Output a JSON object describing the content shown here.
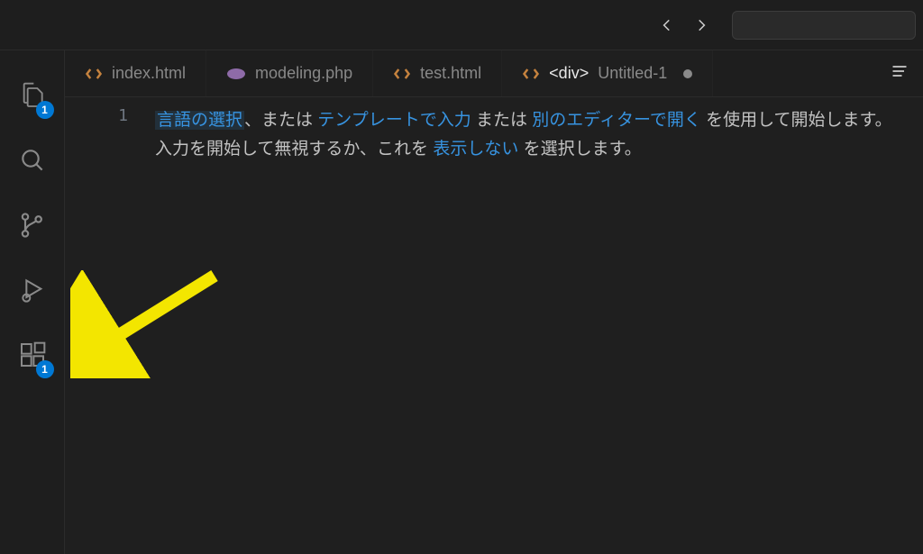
{
  "titlebar": {
    "back": "←",
    "forward": "→"
  },
  "activity": {
    "explorer_badge": "1",
    "extensions_badge": "1"
  },
  "tabs": [
    {
      "label": "index.html",
      "icon": "code",
      "active": false,
      "dirty": false
    },
    {
      "label": "modeling.php",
      "icon": "php",
      "active": false,
      "dirty": false
    },
    {
      "label": "test.html",
      "icon": "code",
      "active": false,
      "dirty": false
    },
    {
      "label": "<div>",
      "sublabel": "Untitled-1",
      "icon": "code",
      "active": true,
      "dirty": true
    }
  ],
  "editor": {
    "line_number": "1",
    "placeholder": {
      "p1_link1": "言語の選択",
      "p1_text1": "、または ",
      "p1_link2": "テンプレートで入力",
      "p1_text2": " または ",
      "p1_link3": "別のエディターで開く",
      "p1_text3": " を使用して開始します。",
      "p2_text1": "入力を開始して無視するか、これを ",
      "p2_link1": "表示しない",
      "p2_text2": " を選択します。"
    }
  },
  "colors": {
    "accent": "#0078d4",
    "link": "#3793e0",
    "annotation": "#f3e600"
  }
}
